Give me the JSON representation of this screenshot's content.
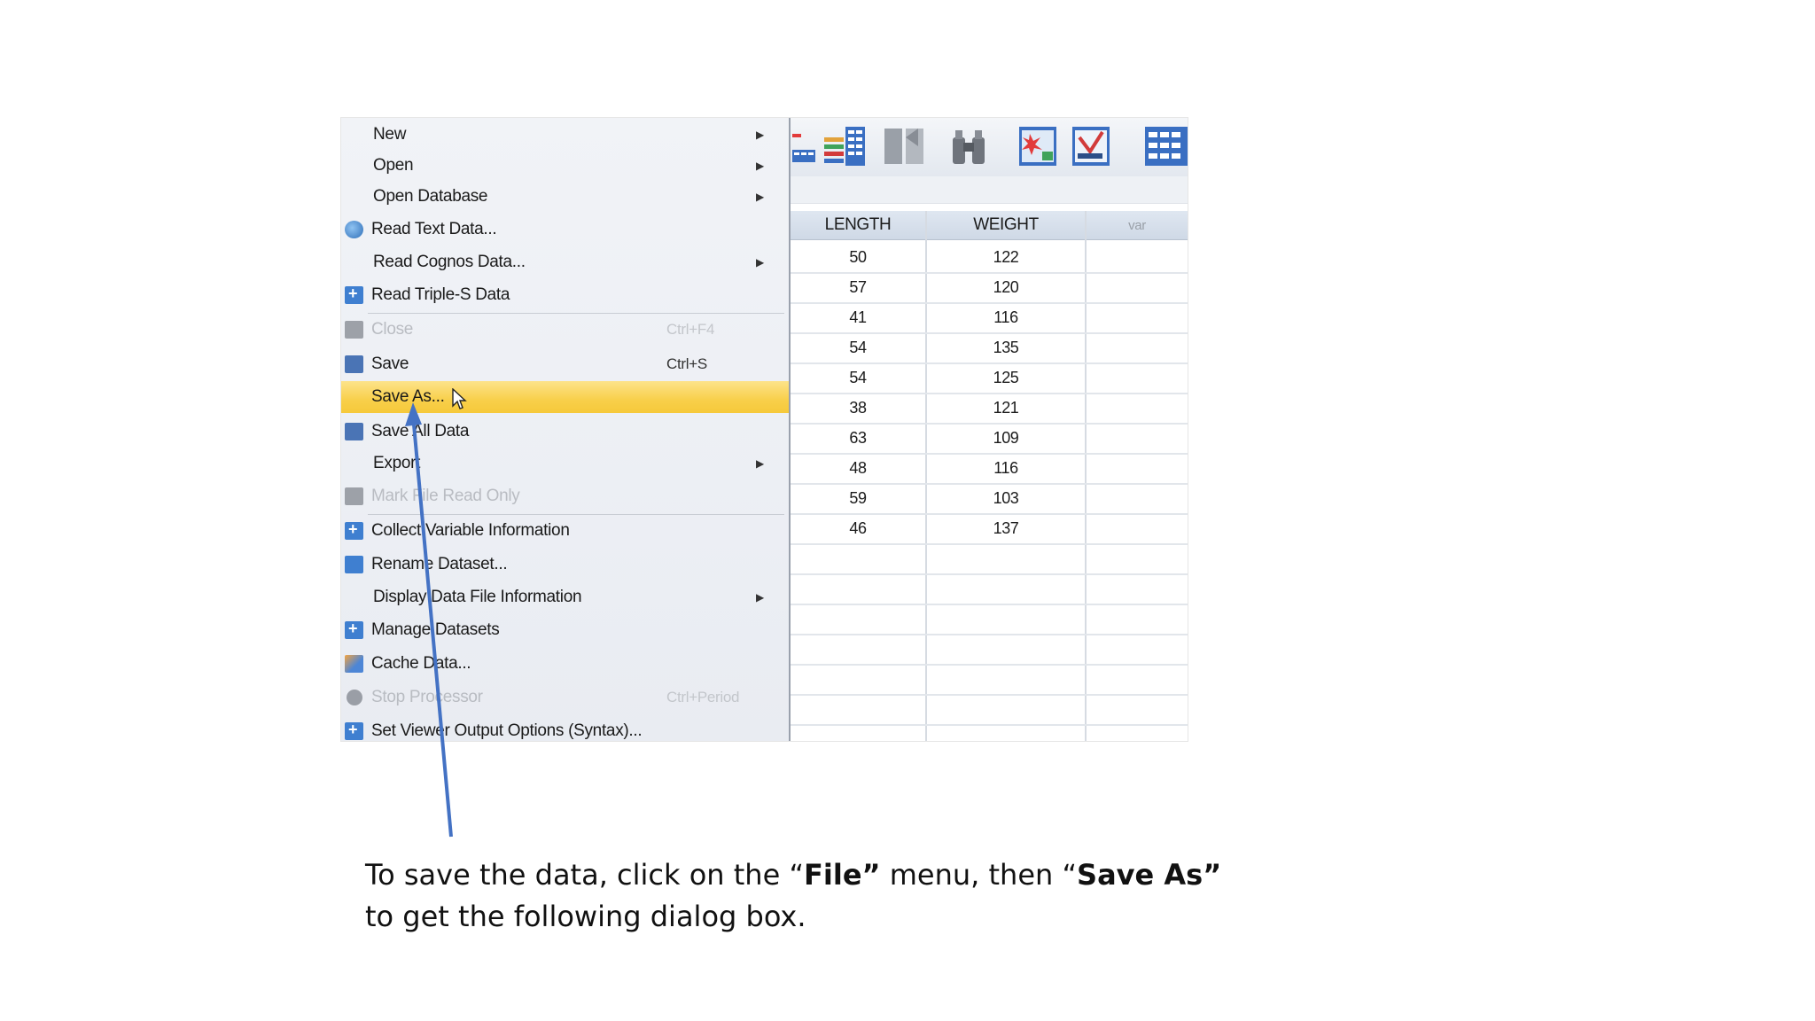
{
  "file_menu": {
    "items": [
      {
        "label": "New",
        "shortcut": "",
        "submenu": true,
        "icon": "",
        "state": "normal"
      },
      {
        "label": "Open",
        "shortcut": "",
        "submenu": true,
        "icon": "",
        "state": "normal"
      },
      {
        "label": "Open Database",
        "shortcut": "",
        "submenu": true,
        "icon": "",
        "state": "normal"
      },
      {
        "label": "Read Text Data...",
        "shortcut": "",
        "submenu": false,
        "icon": "globe-icon",
        "state": "normal"
      },
      {
        "label": "Read Cognos Data...",
        "shortcut": "",
        "submenu": true,
        "icon": "",
        "state": "normal"
      },
      {
        "label": "Read Triple-S Data",
        "shortcut": "",
        "submenu": false,
        "icon": "plus-icon",
        "state": "normal"
      },
      {
        "label": "Close",
        "shortcut": "Ctrl+F4",
        "submenu": false,
        "icon": "close-window-icon",
        "state": "disabled"
      },
      {
        "label": "Save",
        "shortcut": "Ctrl+S",
        "submenu": false,
        "icon": "disk-icon",
        "state": "normal"
      },
      {
        "label": "Save As...",
        "shortcut": "",
        "submenu": false,
        "icon": "",
        "state": "highlighted"
      },
      {
        "label": "Save All Data",
        "shortcut": "",
        "submenu": false,
        "icon": "save-all-icon",
        "state": "normal"
      },
      {
        "label": "Export",
        "shortcut": "",
        "submenu": true,
        "icon": "",
        "state": "normal"
      },
      {
        "label": "Mark File Read Only",
        "shortcut": "",
        "submenu": false,
        "icon": "read-only-icon",
        "state": "disabled"
      },
      {
        "label": "Collect Variable Information",
        "shortcut": "",
        "submenu": false,
        "icon": "plus-icon",
        "state": "normal"
      },
      {
        "label": "Rename Dataset...",
        "shortcut": "",
        "submenu": false,
        "icon": "rename-icon",
        "state": "normal"
      },
      {
        "label": "Display Data File Information",
        "shortcut": "",
        "submenu": true,
        "icon": "",
        "state": "normal"
      },
      {
        "label": "Manage Datasets",
        "shortcut": "",
        "submenu": false,
        "icon": "plus-icon",
        "state": "normal"
      },
      {
        "label": "Cache Data...",
        "shortcut": "",
        "submenu": false,
        "icon": "cache-icon",
        "state": "normal"
      },
      {
        "label": "Stop Processor",
        "shortcut": "Ctrl+Period",
        "submenu": false,
        "icon": "stop-icon",
        "state": "disabled"
      },
      {
        "label": "Set Viewer Output Options (Syntax)...",
        "shortcut": "",
        "submenu": false,
        "icon": "plus-icon",
        "state": "normal"
      }
    ]
  },
  "data_editor": {
    "columns": [
      "LENGTH",
      "WEIGHT",
      "var"
    ],
    "rows": [
      [
        "50",
        "122"
      ],
      [
        "57",
        "120"
      ],
      [
        "41",
        "116"
      ],
      [
        "54",
        "135"
      ],
      [
        "54",
        "125"
      ],
      [
        "38",
        "121"
      ],
      [
        "63",
        "109"
      ],
      [
        "48",
        "116"
      ],
      [
        "59",
        "103"
      ],
      [
        "46",
        "137"
      ]
    ],
    "toolbar_icons": [
      "insert-cases-icon",
      "insert-variable-icon",
      "split-file-icon",
      "find-icon",
      "select-cases-icon",
      "weight-cases-icon",
      "value-labels-icon"
    ]
  },
  "caption": {
    "part1": "To save the data, click on the “",
    "bold1": "File”",
    "part2": " menu, then “",
    "bold2": "Save As”",
    "part3": " to get the following dialog box."
  },
  "colors": {
    "highlight": "#f8cf4a",
    "arrow": "#4472c4",
    "menu_bg": "#eceff4"
  }
}
